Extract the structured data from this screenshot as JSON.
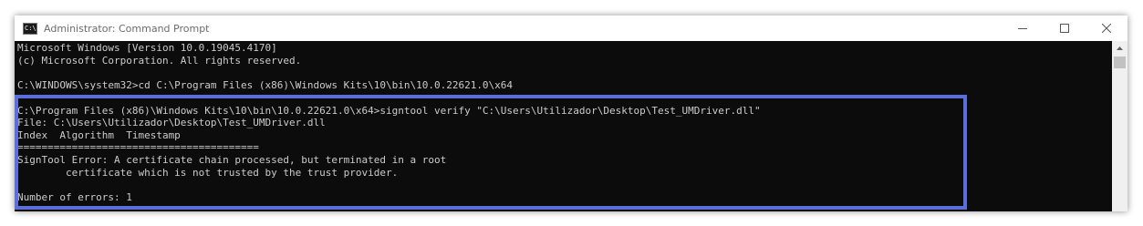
{
  "window": {
    "title": "Administrator: Command Prompt",
    "icon": "cmd-icon",
    "icon_text": "C:\\",
    "controls": [
      "minimize-icon",
      "maximize-icon",
      "close-icon"
    ]
  },
  "console": {
    "lines": [
      "Microsoft Windows [Version 10.0.19045.4170]",
      "(c) Microsoft Corporation. All rights reserved.",
      "",
      "C:\\WINDOWS\\system32>cd C:\\Program Files (x86)\\Windows Kits\\10\\bin\\10.0.22621.0\\x64",
      "",
      "C:\\Program Files (x86)\\Windows Kits\\10\\bin\\10.0.22621.0\\x64>signtool verify \"C:\\Users\\Utilizador\\Desktop\\Test_UMDriver.dll\"",
      "File: C:\\Users\\Utilizador\\Desktop\\Test_UMDriver.dll",
      "Index  Algorithm  Timestamp",
      "========================================",
      "SignTool Error: A certificate chain processed, but terminated in a root",
      "        certificate which is not trusted by the trust provider.",
      "",
      "Number of errors: 1"
    ]
  },
  "colors": {
    "console_bg": "#0c0c0c",
    "console_text": "#cccccc",
    "highlight_border": "#5b6ed9",
    "titlebar_bg": "#ffffff"
  }
}
